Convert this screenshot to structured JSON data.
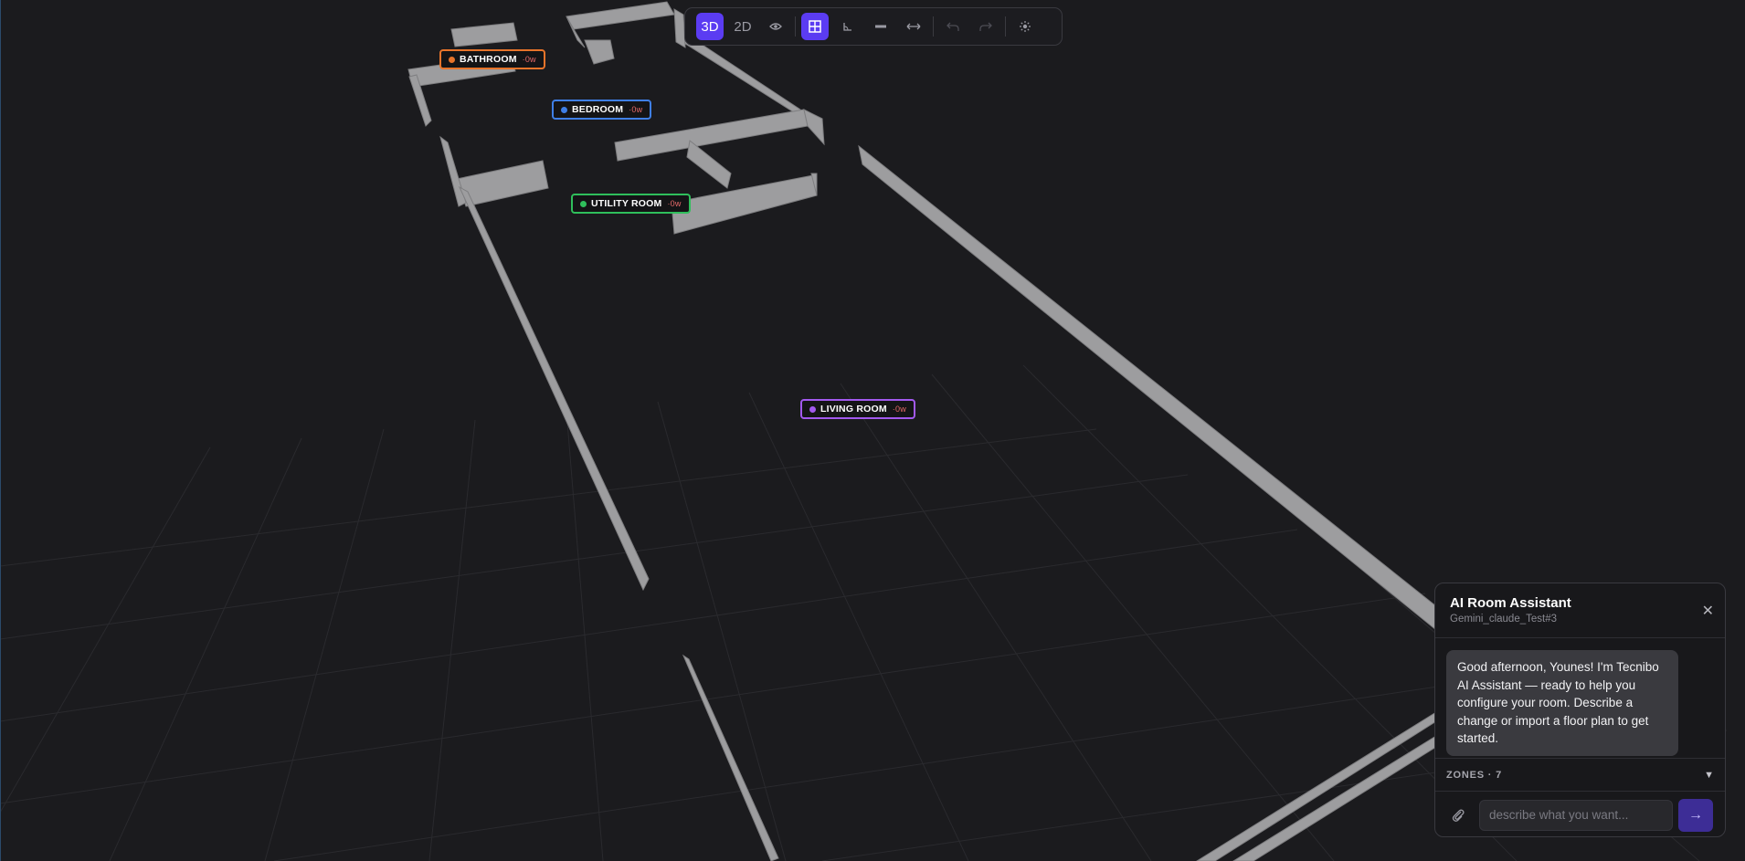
{
  "toolbar": {
    "view_3d": "3D",
    "view_2d": "2D",
    "eye_icon": "eye-icon",
    "grid_icon": "grid-layout-icon",
    "angle_icon": "angle-icon",
    "wall_icon": "wall-tool-icon",
    "measure_icon": "measure-icon",
    "undo_icon": "undo-icon",
    "redo_icon": "redo-icon",
    "light_icon": "sun-icon"
  },
  "rooms": [
    {
      "name": "BATHROOM",
      "watt": "·0w",
      "color": "#e8742a"
    },
    {
      "name": "BEDROOM",
      "watt": "·0w",
      "color": "#3f7fe6"
    },
    {
      "name": "UTILITY ROOM",
      "watt": "·0w",
      "color": "#2fbf5b"
    },
    {
      "name": "LIVING ROOM",
      "watt": "·0w",
      "color": "#a259ee"
    }
  ],
  "chat": {
    "title": "AI Room Assistant",
    "subtitle": "Gemini_claude_Test#3",
    "message": "Good afternoon, Younes! I'm Tecnibo AI Assistant — ready to help you configure your room. Describe a change or import a floor plan to get started.",
    "zones_label": "ZONES · 7",
    "placeholder": "describe what you want...",
    "send_icon": "→"
  },
  "colors": {
    "accent": "#5b3cf2",
    "wall": "#9a9a9c",
    "background": "#1b1b1e"
  }
}
